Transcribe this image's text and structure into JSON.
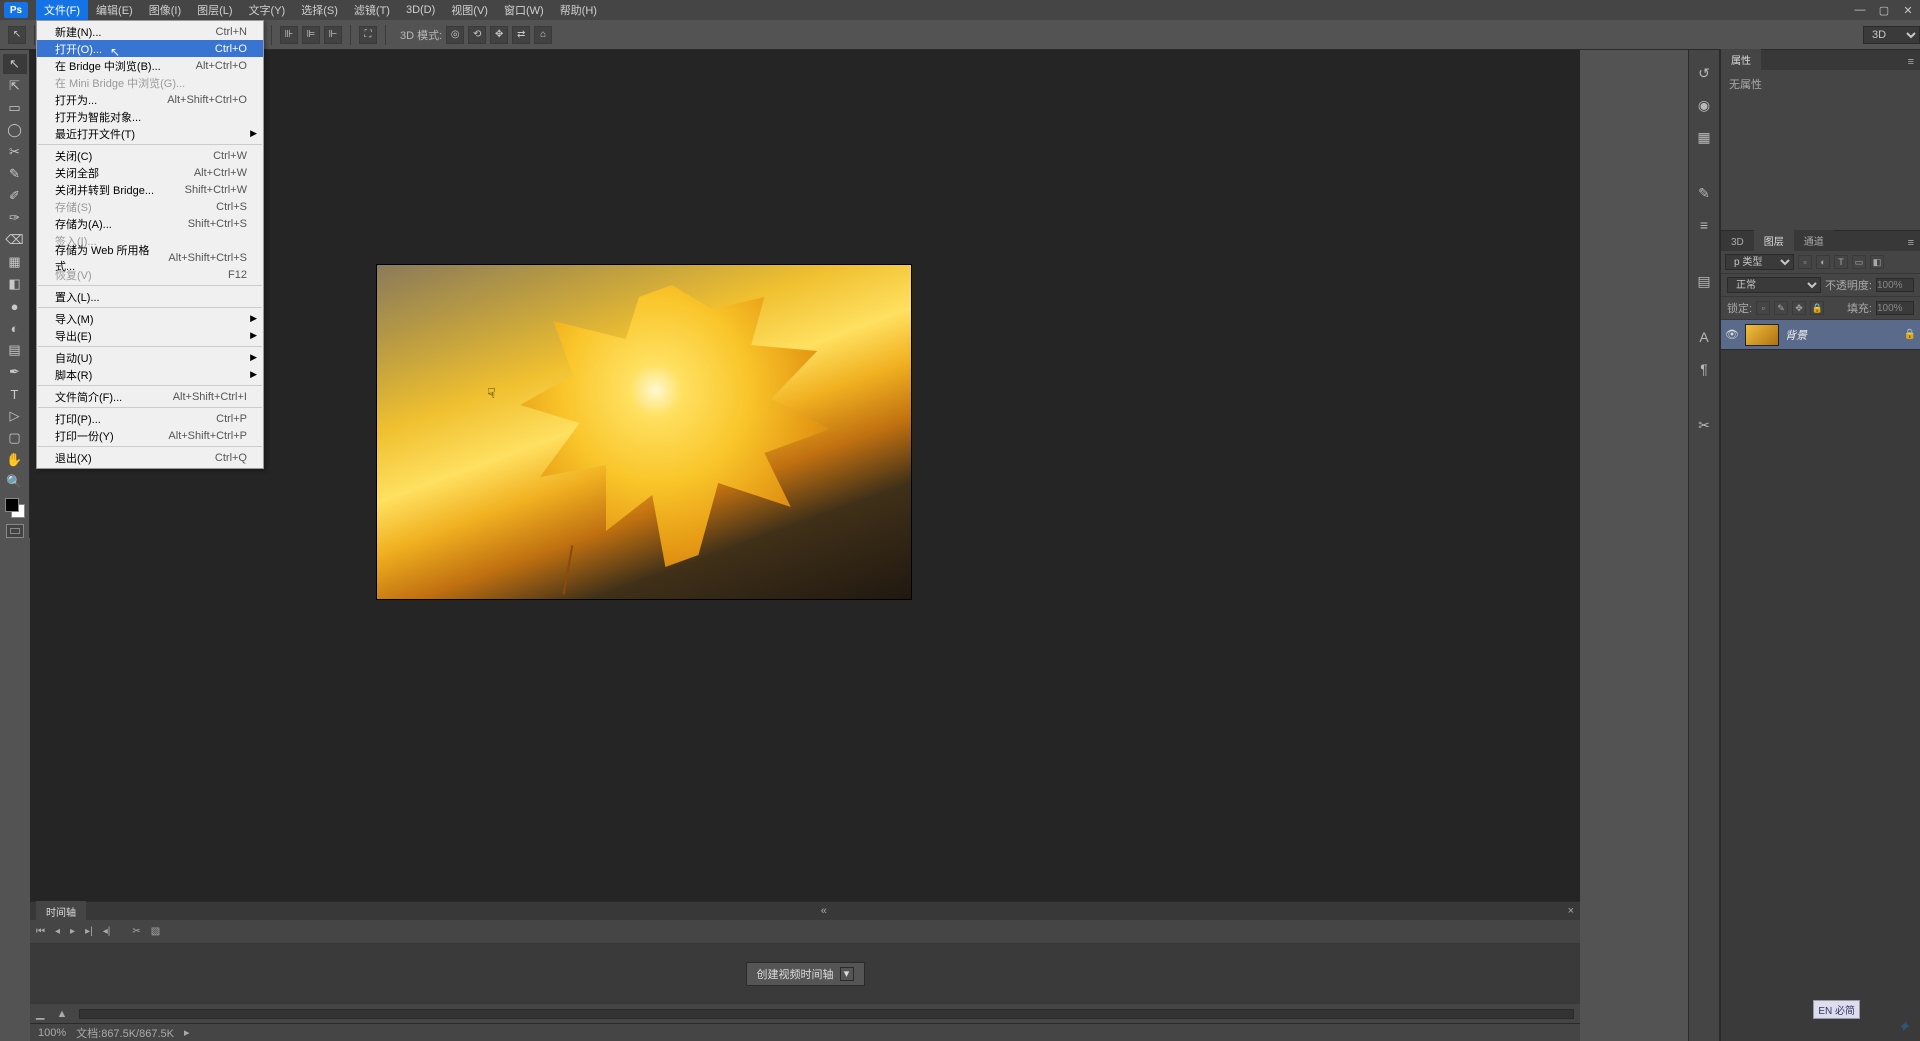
{
  "menubar": {
    "items": [
      "文件(F)",
      "编辑(E)",
      "图像(I)",
      "图层(L)",
      "文字(Y)",
      "选择(S)",
      "滤镜(T)",
      "3D(D)",
      "视图(V)",
      "窗口(W)",
      "帮助(H)"
    ]
  },
  "file_menu": {
    "groups": [
      [
        {
          "label": "新建(N)...",
          "shortcut": "Ctrl+N",
          "enabled": true
        },
        {
          "label": "打开(O)...",
          "shortcut": "Ctrl+O",
          "enabled": true,
          "hover": true
        },
        {
          "label": "在 Bridge 中浏览(B)...",
          "shortcut": "Alt+Ctrl+O",
          "enabled": true
        },
        {
          "label": "在 Mini Bridge 中浏览(G)...",
          "shortcut": "",
          "enabled": false
        },
        {
          "label": "打开为...",
          "shortcut": "Alt+Shift+Ctrl+O",
          "enabled": true
        },
        {
          "label": "打开为智能对象...",
          "shortcut": "",
          "enabled": true
        },
        {
          "label": "最近打开文件(T)",
          "shortcut": "",
          "enabled": true,
          "sub": true
        }
      ],
      [
        {
          "label": "关闭(C)",
          "shortcut": "Ctrl+W",
          "enabled": true
        },
        {
          "label": "关闭全部",
          "shortcut": "Alt+Ctrl+W",
          "enabled": true
        },
        {
          "label": "关闭并转到 Bridge...",
          "shortcut": "Shift+Ctrl+W",
          "enabled": true
        },
        {
          "label": "存储(S)",
          "shortcut": "Ctrl+S",
          "enabled": false
        },
        {
          "label": "存储为(A)...",
          "shortcut": "Shift+Ctrl+S",
          "enabled": true
        },
        {
          "label": "签入(I)...",
          "shortcut": "",
          "enabled": false
        },
        {
          "label": "存储为 Web 所用格式...",
          "shortcut": "Alt+Shift+Ctrl+S",
          "enabled": true
        },
        {
          "label": "恢复(V)",
          "shortcut": "F12",
          "enabled": false
        }
      ],
      [
        {
          "label": "置入(L)...",
          "shortcut": "",
          "enabled": true
        }
      ],
      [
        {
          "label": "导入(M)",
          "shortcut": "",
          "enabled": true,
          "sub": true
        },
        {
          "label": "导出(E)",
          "shortcut": "",
          "enabled": true,
          "sub": true
        }
      ],
      [
        {
          "label": "自动(U)",
          "shortcut": "",
          "enabled": true,
          "sub": true
        },
        {
          "label": "脚本(R)",
          "shortcut": "",
          "enabled": true,
          "sub": true
        }
      ],
      [
        {
          "label": "文件简介(F)...",
          "shortcut": "Alt+Shift+Ctrl+I",
          "enabled": true
        }
      ],
      [
        {
          "label": "打印(P)...",
          "shortcut": "Ctrl+P",
          "enabled": true
        },
        {
          "label": "打印一份(Y)",
          "shortcut": "Alt+Shift+Ctrl+P",
          "enabled": true
        }
      ],
      [
        {
          "label": "退出(X)",
          "shortcut": "Ctrl+Q",
          "enabled": true
        }
      ]
    ]
  },
  "options": {
    "mode_label": "3D 模式:",
    "right_select": "3D"
  },
  "tools": [
    "↖",
    "⇱",
    "▭",
    "◯",
    "✂",
    "✎",
    "✐",
    "✑",
    "⌫",
    "▦",
    "◧",
    "●",
    "◐",
    "▤",
    "✒",
    "T",
    "▷",
    "▢",
    "✋",
    "🔍"
  ],
  "properties": {
    "tab": "属性",
    "none": "无属性"
  },
  "layers": {
    "tabs": [
      "3D",
      "图层",
      "通道"
    ],
    "active_tab": 1,
    "kind_label": "p 类型",
    "blend": "正常",
    "opacity_label": "不透明度:",
    "opacity": "100%",
    "lock_label": "锁定:",
    "fill_label": "填充:",
    "fill": "100%",
    "layer0": "背景"
  },
  "timeline": {
    "tab": "时间轴",
    "create": "创建视频时间轴"
  },
  "status": {
    "zoom": "100%",
    "docinfo": "文档:867.5K/867.5K"
  },
  "ime": "EN 必简",
  "colors": {
    "accent": "#1473e6",
    "panel": "#454545",
    "canvas": "#252525"
  }
}
